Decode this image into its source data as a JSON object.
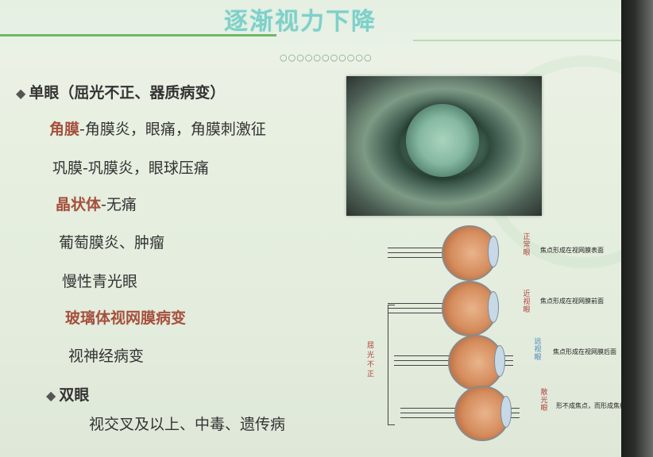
{
  "title": "逐渐视力下降",
  "dots": "○○○○○○○○○○○",
  "lines": {
    "monocular_head": "单眼",
    "monocular_paren": "（屈光不正、器质病变）",
    "cornea_head": "角膜",
    "cornea_rest": "-角膜炎，眼痛，角膜刺激征",
    "sclera": "巩膜-巩膜炎，眼球压痛",
    "lens_head": "晶状体",
    "lens_rest": "-无痛",
    "uveitis": "葡萄膜炎、肿瘤",
    "glaucoma": "慢性青光眼",
    "vitreous": "玻璃体视网膜病变",
    "optic": "视神经病变",
    "binocular_head": "双眼",
    "binocular_rest": "视交叉及以上、中毒、遗传病"
  },
  "diagram": {
    "side_label": "屈光不正",
    "rows": [
      {
        "label": "正常眼",
        "desc": "焦点形成在视网膜表面"
      },
      {
        "label": "近视眼",
        "desc": "焦点形成在视网膜前面"
      },
      {
        "label": "远视眼",
        "desc": "焦点形成在视网膜后面"
      },
      {
        "label": "散光眼",
        "desc": "形不成焦点，而形成焦线"
      }
    ]
  },
  "colors": {
    "accent": "#a5503c",
    "title": "#7fd0c8",
    "label_red": "#b2403a"
  }
}
